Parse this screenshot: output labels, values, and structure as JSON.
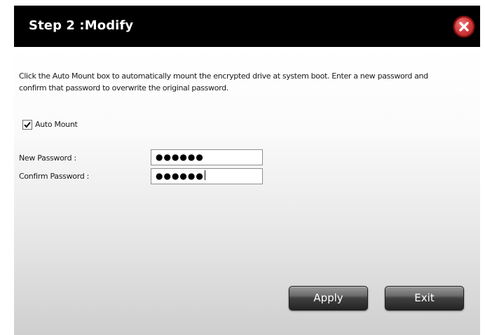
{
  "dialog": {
    "title": "Step 2 :Modify",
    "description_lines": [
      "Click the Auto Mount box to automatically mount the encrypted drive at system boot. Enter a new password and",
      "confirm that password to overwrite the original password."
    ],
    "auto_mount": {
      "label": "Auto Mount",
      "checked": true
    },
    "new_password": {
      "label": "New Password :",
      "value": "●●●●●●"
    },
    "confirm_password": {
      "label": "Confirm Password :",
      "value": "●●●●●●"
    },
    "buttons": {
      "apply": "Apply",
      "exit": "Exit"
    }
  },
  "colors": {
    "titlebar_bg": "#000000",
    "close_button": "#d43c3c",
    "button_dark": "#242424"
  },
  "icons": {
    "close": "close-icon",
    "checkmark": "checkmark-icon"
  }
}
